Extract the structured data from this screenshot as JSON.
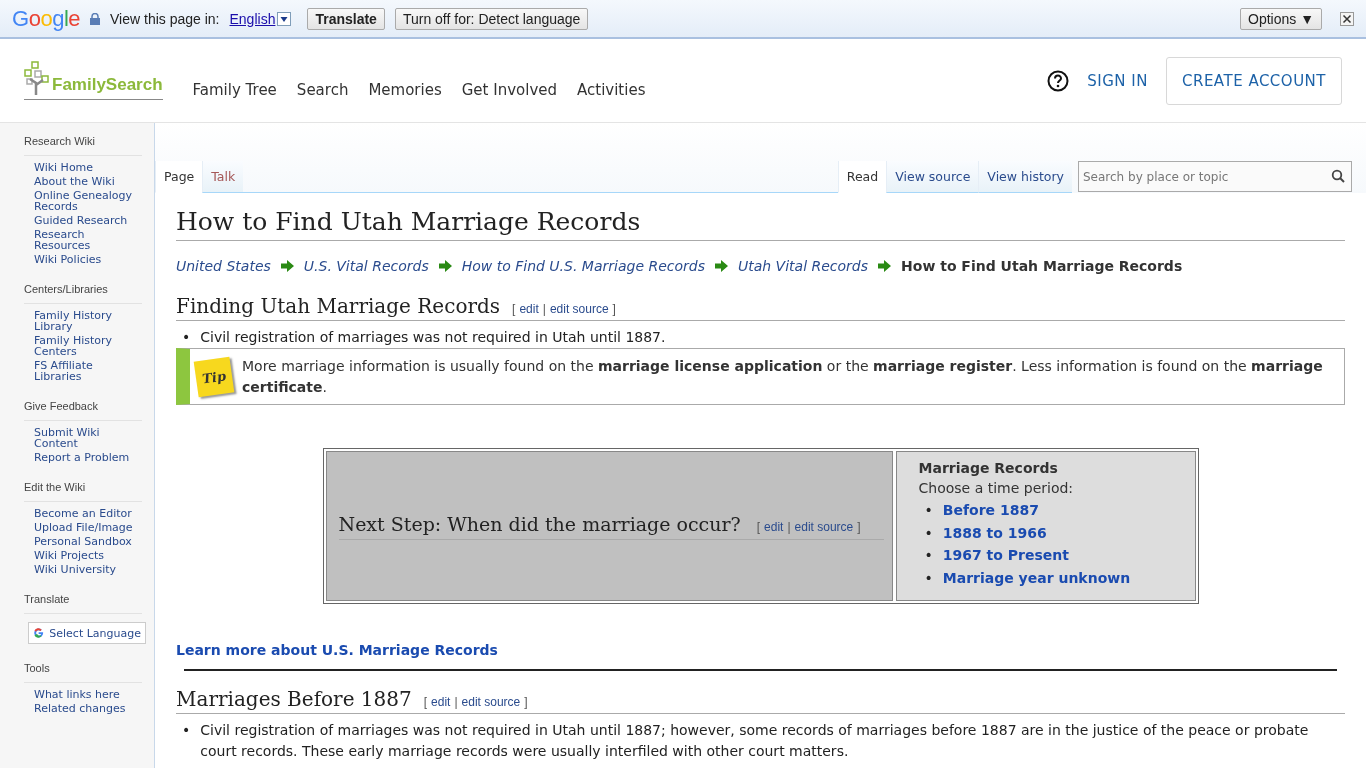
{
  "translate_bar": {
    "logo": "Google",
    "label": "View this page in:",
    "language": "English",
    "buttons": [
      "Translate",
      "Turn off for: Detect language"
    ],
    "options": "Options ▼"
  },
  "header": {
    "logo": "FamilySearch",
    "nav": [
      "Family Tree",
      "Search",
      "Memories",
      "Get Involved",
      "Activities"
    ],
    "sign_in": "SIGN IN",
    "create_account": "CREATE ACCOUNT"
  },
  "sidebar": {
    "sections": [
      {
        "title": "Research Wiki",
        "items": [
          "Wiki Home",
          "About the Wiki",
          "Online Genealogy Records",
          "Guided Research",
          "Research Resources",
          "Wiki Policies"
        ]
      },
      {
        "title": "Centers/Libraries",
        "items": [
          "Family History Library",
          "Family History Centers",
          "FS Affiliate Libraries"
        ]
      },
      {
        "title": "Give Feedback",
        "items": [
          "Submit Wiki Content",
          "Report a Problem"
        ]
      },
      {
        "title": "Edit the Wiki",
        "items": [
          "Become an Editor",
          "Upload File/Image",
          "Personal Sandbox",
          "Wiki Projects",
          "Wiki University"
        ]
      },
      {
        "title": "Translate",
        "widget": "Select Language"
      },
      {
        "title": "Tools",
        "items": [
          "What links here",
          "Related changes"
        ]
      }
    ]
  },
  "tabs": {
    "left": [
      {
        "label": "Page",
        "selected": true
      },
      {
        "label": "Talk",
        "selected": false
      }
    ],
    "right": [
      {
        "label": "Read",
        "selected": true
      },
      {
        "label": "View source",
        "selected": false
      },
      {
        "label": "View history",
        "selected": false
      }
    ],
    "search": {
      "placeholder": "Search by place or topic"
    }
  },
  "article": {
    "title": "How to Find Utah Marriage Records",
    "breadcrumbs": [
      "United States",
      "U.S. Vital Records",
      "How to Find U.S. Marriage Records",
      "Utah Vital Records"
    ],
    "breadcrumb_current": "How to Find Utah Marriage Records",
    "section_1": {
      "heading": "Finding Utah Marriage Records",
      "edit_links": {
        "open": "[",
        "links": [
          "edit",
          "edit source"
        ],
        "separator": "|",
        "close": "]"
      },
      "bullets": [
        {
          "marker": "•",
          "text": "Civil registration of marriages was not required in Utah until 1887."
        }
      ],
      "tip": {
        "label": "Tip",
        "text": "More marriage information is usually found on the **marriage license application** or the **marriage register**. Less information is found on the **marriage certificate**."
      }
    },
    "next_step": {
      "heading": "Next Step: When did the marriage occur?",
      "edit_links": {
        "open": "[",
        "links": [
          "edit",
          "edit source"
        ],
        "separator": "|",
        "close": "]"
      },
      "panel_title": "Marriage Records",
      "panel_subtitle": "Choose a time period:",
      "links": [
        {
          "marker": "•",
          "text": "Before 1887"
        },
        {
          "marker": "•",
          "text": "1888 to 1966"
        },
        {
          "marker": "•",
          "text": "1967 to Present"
        },
        {
          "marker": "•",
          "text": "Marriage year unknown"
        }
      ]
    },
    "learn_more": "Learn more about U.S. Marriage Records",
    "section_2": {
      "heading": "Marriages Before 1887",
      "edit_links": {
        "open": "[",
        "links": [
          "edit",
          "edit source"
        ],
        "separator": "|",
        "close": "]"
      },
      "bullets": [
        {
          "marker": "•",
          "text": "Civil registration of marriages was not required in Utah until 1887; however, some records of marriages before 1887 are in the justice of the peace or probate court records. These early marriage records were usually interfiled with other court matters."
        }
      ]
    }
  }
}
